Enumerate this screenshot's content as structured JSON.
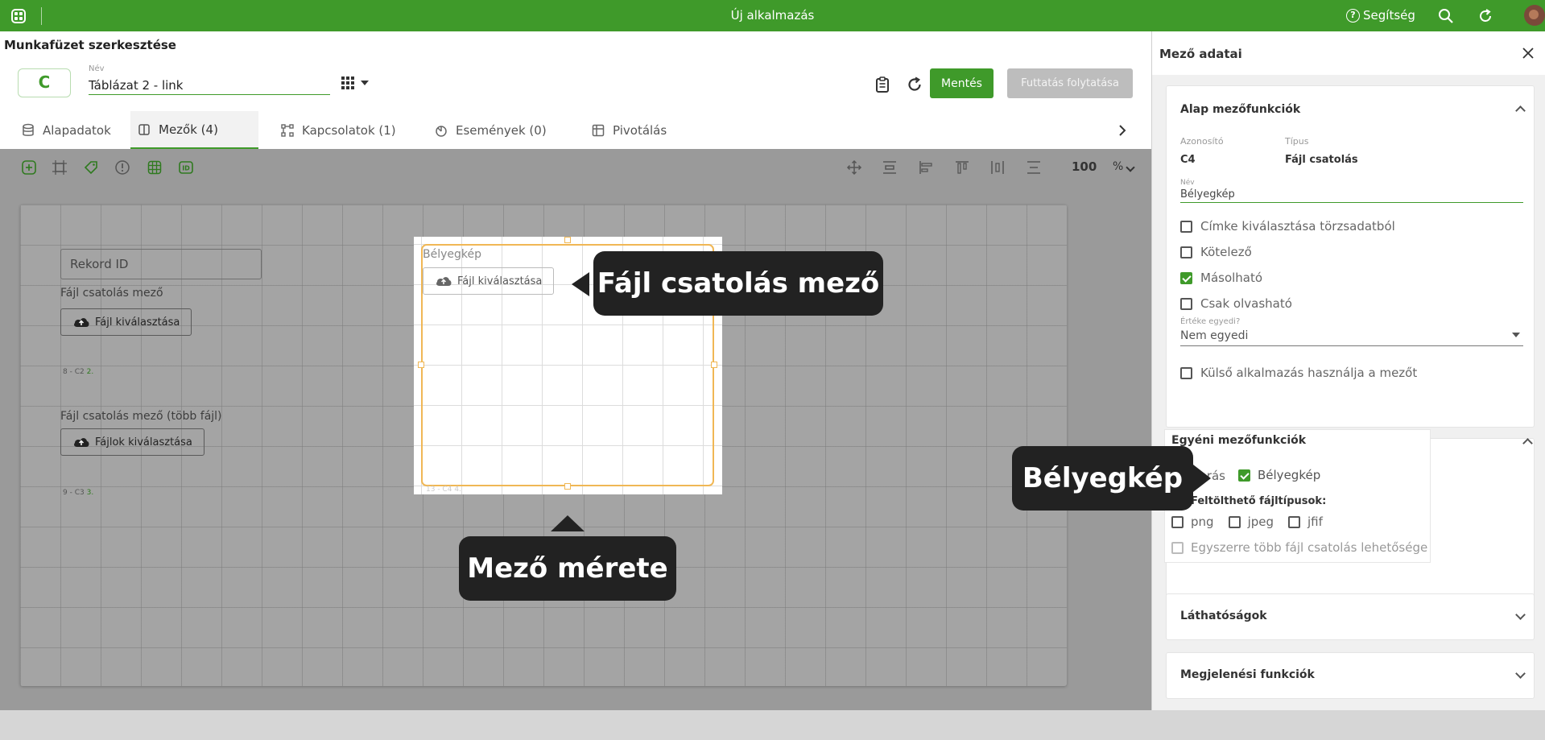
{
  "topbar": {
    "title": "Új alkalmazás",
    "help_label": "Segítség",
    "bg_color": "#3f9a2a"
  },
  "header": {
    "page_title": "Munkafüzet szerkesztése",
    "badge_letter": "C",
    "name_label": "Név",
    "name_value": "Táblázat 2 - link",
    "save_label": "Mentés",
    "run_label": "Futtatás folytatása"
  },
  "tabs": [
    {
      "label": "Alapadatok",
      "icon": "database-icon"
    },
    {
      "label": "Mezők (4)",
      "icon": "field-icon"
    },
    {
      "label": "Kapcsolatok (1)",
      "icon": "relations-icon"
    },
    {
      "label": "Események (0)",
      "icon": "events-icon"
    },
    {
      "label": "Pivotálás",
      "icon": "pivot-icon"
    }
  ],
  "canvas": {
    "zoom_value": "100",
    "zoom_unit": "%",
    "fields": {
      "rekord_id": "Rekord ID",
      "file_field_label": "Fájl csatolás mező",
      "file_button": "Fájl kiválasztása",
      "file_field_id": "8 - C2",
      "file_field_order": "2.",
      "multi_field_label": "Fájl csatolás mező (több fájl)",
      "multi_button": "Fájlok kiválasztása",
      "multi_field_id": "9 - C3",
      "multi_field_order": "3."
    },
    "focus": {
      "label": "Bélyegkép",
      "button": "Fájl kiválasztása",
      "id": "13 - C4",
      "order": "4."
    }
  },
  "panel": {
    "title": "Mező adatai",
    "basic_section": {
      "title": "Alap mezőfunkciók",
      "id_label": "Azonosító",
      "id_value": "C4",
      "type_label": "Típus",
      "type_value": "Fájl csatolás",
      "name_label": "Név",
      "name_value": "Bélyegkép",
      "checkboxes": [
        {
          "label": "Címke kiválasztása törzsadatból",
          "checked": false
        },
        {
          "label": "Kötelező",
          "checked": false
        },
        {
          "label": "Másolható",
          "checked": true
        },
        {
          "label": "Csak olvasható",
          "checked": false
        }
      ],
      "unique_label": "Értéke egyedi?",
      "unique_value": "Nem egyedi",
      "external_label": "Külső alkalmazás használja a mezőt"
    },
    "custom_section": {
      "title": "Egyéni mezőfunkciók",
      "display_label_partial": "Ab",
      "display_label_rest": "rás",
      "thumbnail_label": "Bélyegkép",
      "filetypes_label": "Feltölthető fájltípusok:",
      "filetypes": [
        "png",
        "jpeg",
        "jfif"
      ],
      "multi_label": "Egyszerre több fájl csatolás lehetősége"
    },
    "visibility_title": "Láthatóságok",
    "display_title": "Megjelenési funkciók"
  },
  "callouts": {
    "file_field": "Fájl csatolás mező",
    "field_size": "Mező mérete",
    "thumbnail": "Bélyegkép"
  }
}
